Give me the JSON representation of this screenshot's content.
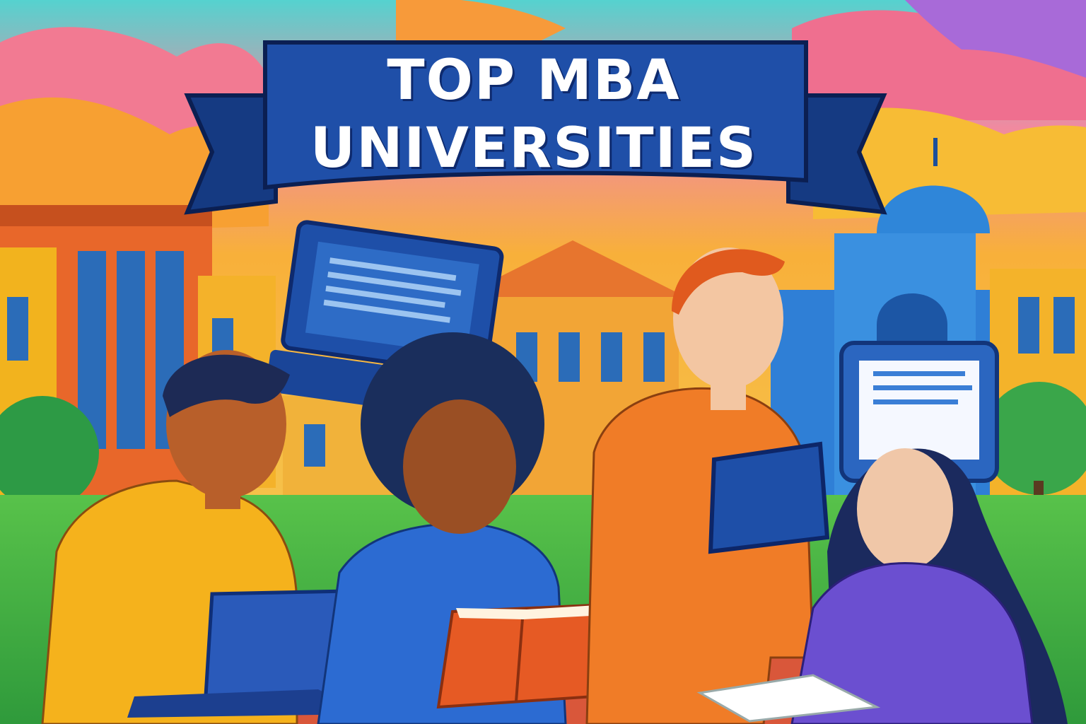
{
  "banner": {
    "line1": "TOP MBA",
    "line2": "UNIVERSITIES"
  },
  "scene": {
    "palette": {
      "sky_pink": "#f0708c",
      "sky_orange": "#f7a23a",
      "sky_teal": "#4fd3cf",
      "sky_purple": "#b06ad6",
      "banner_blue": "#1f4fa8",
      "banner_dark": "#153a82",
      "grass": "#3bb04a",
      "building_orange": "#e96a2c",
      "building_yellow": "#f2b51f",
      "building_blue": "#2f7fd6"
    },
    "objects": [
      "banner",
      "laptop-screen-icon",
      "tablet-screen-icon",
      "laptop",
      "book",
      "tablet",
      "paper",
      "students",
      "campus-buildings",
      "trees"
    ]
  }
}
